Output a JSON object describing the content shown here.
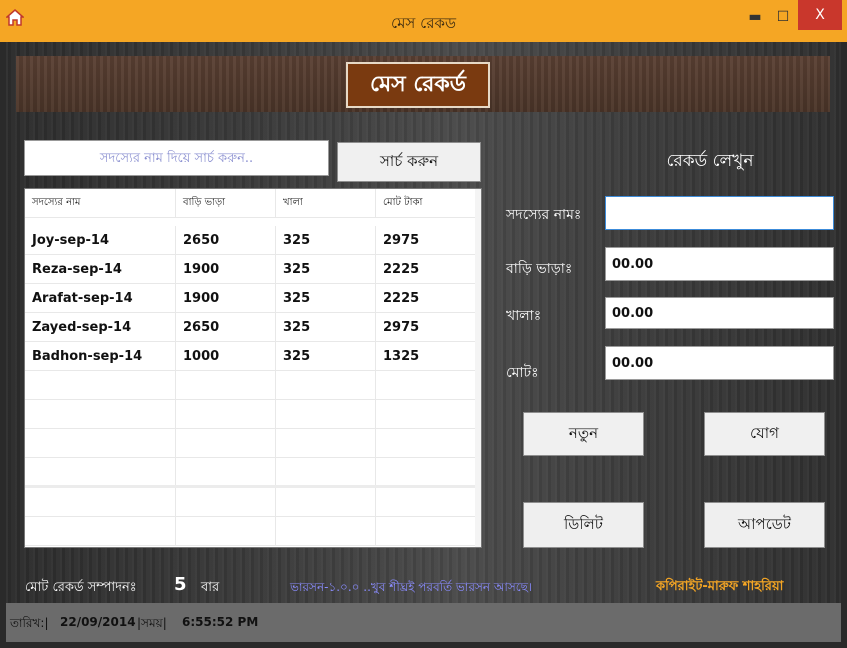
{
  "window": {
    "title": "মেস রেকড",
    "minimize_label": "▬",
    "maximize_label": "☐",
    "close_label": "X",
    "title_bar_color": "#f5a624",
    "close_color": "#c9372c"
  },
  "header": {
    "title": "মেস রেকর্ড",
    "title_bg": "#7a3a10"
  },
  "search": {
    "placeholder": "সদস্যের নাম দিয়ে সার্চ করুন..",
    "button_label": "সার্চ করুন"
  },
  "table": {
    "columns": [
      "সদস্যের নাম",
      "বাড়ি ভাড়া",
      "খালা",
      "মোট টাকা"
    ],
    "rows": [
      [
        "Joy-sep-14",
        "2650",
        "325",
        "2975"
      ],
      [
        "Reza-sep-14",
        "1900",
        "325",
        "2225"
      ],
      [
        "Arafat-sep-14",
        "1900",
        "325",
        "2225"
      ],
      [
        "Zayed-sep-14",
        "2650",
        "325",
        "2975"
      ],
      [
        "Badhon-sep-14",
        "1000",
        "325",
        "1325"
      ]
    ]
  },
  "form": {
    "title": "রেকর্ড লেখুন",
    "name_label": "সদস্যের নামঃ",
    "name_value": "",
    "rent_label": "বাড়ি ভাড়াঃ",
    "rent_value": "00.00",
    "meal_label": "খালাঃ",
    "meal_value": "00.00",
    "total_label": "মোটঃ",
    "total_value": "00.00"
  },
  "buttons": {
    "new": "নতুন",
    "add": "যোগ",
    "delete": "ডিলিট",
    "update": "আপডেট"
  },
  "footer": {
    "count_label": "মোট রেকর্ড সম্পাদনঃ",
    "count_value": "5",
    "count_unit": "বার",
    "version_text": "ভারসন-১.০.০ ..খুব শীঘ্রই পরবর্তি ভারসন আসছে।",
    "version_color": "#8a8cff",
    "copyright": "কপিরাইট-মারুফ শাহরিয়া",
    "copyright_color": "#f5a624"
  },
  "statusbar": {
    "date_label": "তারিখ:|",
    "date_value": "22/09/2014",
    "time_label": "|সময়|",
    "time_value": "6:55:52 PM"
  }
}
